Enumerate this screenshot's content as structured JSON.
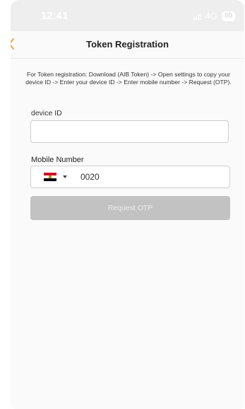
{
  "status_bar": {
    "time": "12:41",
    "network": "4G",
    "battery": "80"
  },
  "header": {
    "title": "Token Registration",
    "back_icon": "chevron-left-icon"
  },
  "instructions": "For Token registration: Download (AIB Token) -> Open settings to copy your device ID -> Enter your device ID -> Enter mobile number -> Request (OTP).",
  "form": {
    "device_id_label": "device ID",
    "device_id_value": "",
    "mobile_label": "Mobile Number",
    "country_flag": "egypt-flag-icon",
    "phone_value": "0020",
    "request_otp_label": "Request OTP"
  },
  "colors": {
    "accent": "#f0a640",
    "button_disabled": "#c2c2c2",
    "button_text_disabled": "#ececec",
    "status_bar": "#eeeeee",
    "input_border": "#cfcfcf"
  }
}
